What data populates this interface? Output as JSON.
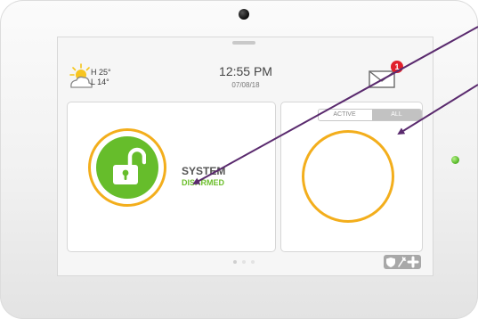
{
  "weather": {
    "high": "H 25°",
    "low": "L 14°",
    "icon": "partly-cloudy-icon"
  },
  "clock": {
    "time": "12:55 PM",
    "date": "07/08/18"
  },
  "messages": {
    "badge_count": "1",
    "icon": "envelope-icon"
  },
  "security": {
    "label": "SYSTEM",
    "status": "DISARMED",
    "status_color": "#6cbf2c",
    "icon": "unlocked-padlock-icon"
  },
  "filter": {
    "active_label": "ACTIVE",
    "all_label": "ALL",
    "selected": "ALL"
  },
  "pager": {
    "current_page": 1,
    "page_count": 3
  },
  "quick_actions": {
    "icons": [
      "shield-icon",
      "wand-icon",
      "plus-icon"
    ]
  },
  "colors": {
    "accent_ring": "#f3ae1c",
    "lock_green": "#66bd2b",
    "badge_red": "#e0202a",
    "arrow": "#5a2a6e",
    "led": "#5cbc2d"
  }
}
